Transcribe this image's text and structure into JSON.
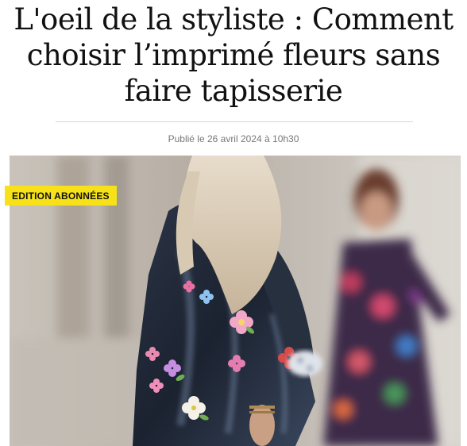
{
  "article": {
    "title": "L'oeil de la styliste : Comment choisir l’imprimé fleurs sans faire tapisserie",
    "published": "Publié le 26 avril 2024 à 10h30",
    "badge": "Edition abonnées"
  },
  "colors": {
    "badge_bg": "#f7e21a",
    "title": "#111111",
    "meta": "#777777",
    "rule": "#d6d6d6"
  }
}
